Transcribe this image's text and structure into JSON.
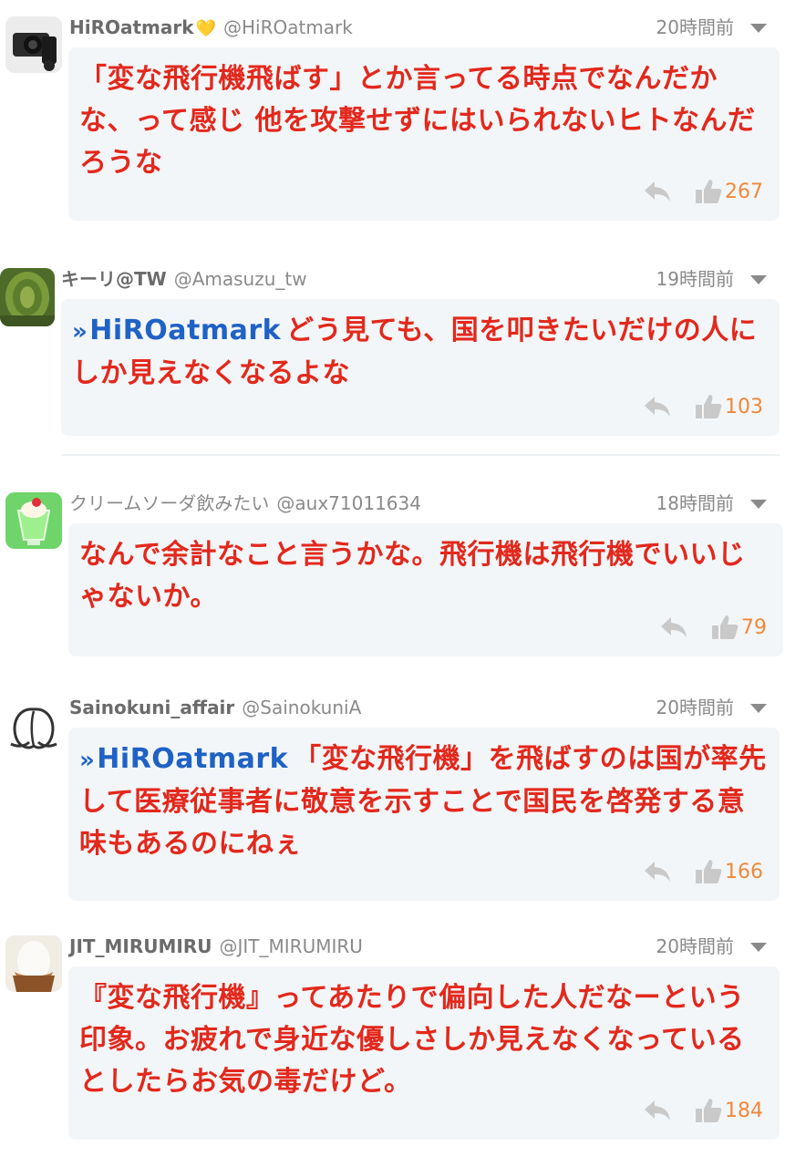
{
  "comments": [
    {
      "name": "HiROatmark",
      "has_heart": true,
      "handle": "@HiROatmark",
      "time": "20時間前",
      "mention": "",
      "text": "「変な飛行機飛ばす」とか言ってる時点でなんだかな、って感じ 他を攻撃せずにはいられないヒトなんだろうな",
      "likes": "267",
      "avatar_icon": "camera-photo-avatar"
    },
    {
      "name": "キーリ@TW",
      "has_heart": false,
      "handle": "@Amasuzu_tw",
      "time": "19時間前",
      "mention": "HiROatmark",
      "text": "どう見ても、国を叩きたいだけの人にしか見えなくなるよな",
      "likes": "103",
      "avatar_icon": "green-moss-avatar"
    },
    {
      "name": "クリームソーダ飲みたい",
      "has_heart": false,
      "handle": "@aux71011634",
      "time": "18時間前",
      "mention": "",
      "text": "なんで余計なこと言うかな。飛行機は飛行機でいいじゃないか。",
      "likes": "79",
      "avatar_icon": "cream-soda-avatar"
    },
    {
      "name": "Sainokuni_affair",
      "has_heart": false,
      "handle": "@SainokuniA",
      "time": "20時間前",
      "mention": "HiROatmark",
      "text": "「変な飛行機」を飛ばすのは国が率先して医療従事者に敬意を示すことで国民を啓発する意味もあるのにねぇ",
      "likes": "166",
      "avatar_icon": "peach-outline-avatar"
    },
    {
      "name": "JIT_MIRUMIRU",
      "has_heart": false,
      "handle": "@JIT_MIRUMIRU",
      "time": "20時間前",
      "mention": "",
      "text": "『変な飛行機』ってあたりで偏向した人だなーという印象。お疲れで身近な優しさしか見えなくなっているとしたらお気の毒だけど。",
      "likes": "184",
      "avatar_icon": "egg-avatar"
    }
  ],
  "mention_prefix": "»",
  "heart_glyph": "💛",
  "colors": {
    "body_text": "#e3281c",
    "mention": "#1f62c6",
    "like_count": "#f0883a",
    "meta": "#8a8a8a",
    "bubble": "#f3f6f8"
  }
}
